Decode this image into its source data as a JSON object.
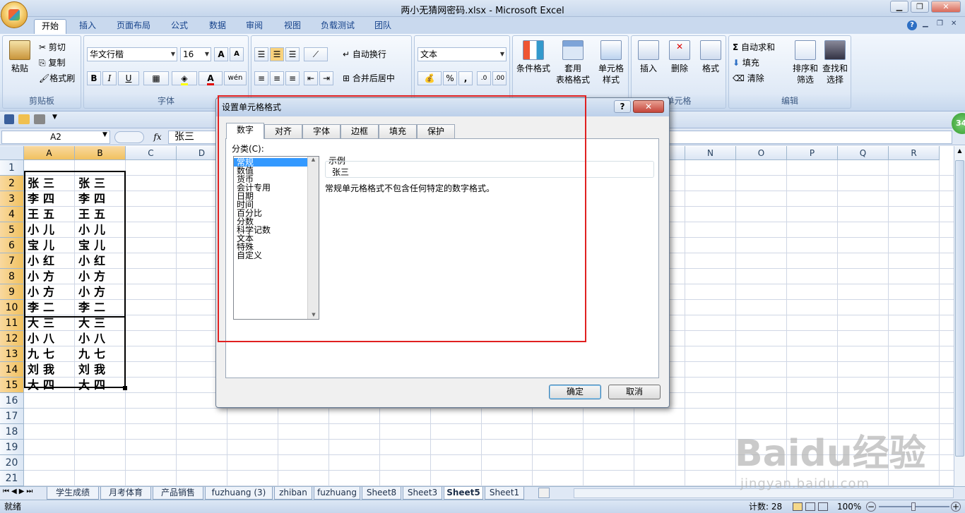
{
  "window": {
    "title": "两小无猜网密码.xlsx - Microsoft Excel"
  },
  "ribbon": {
    "tabs": [
      "开始",
      "插入",
      "页面布局",
      "公式",
      "数据",
      "审阅",
      "视图",
      "负载测试",
      "团队"
    ],
    "active_tab": "开始",
    "clipboard": {
      "paste": "粘贴",
      "cut": "剪切",
      "copy": "复制",
      "format_painter": "格式刷",
      "group": "剪贴板"
    },
    "font": {
      "name": "华文行楷",
      "size": "16",
      "bold": "B",
      "italic": "I",
      "underline": "U",
      "phonetic": "wén",
      "group": "字体"
    },
    "alignment": {
      "wrap": "自动换行",
      "merge": "合并后居中"
    },
    "number": {
      "format": "文本",
      "percent": "%",
      "comma": ","
    },
    "styles": {
      "conditional": "条件格式",
      "table": "套用\n表格格式",
      "cell": "单元格\n样式"
    },
    "cells": {
      "insert": "插入",
      "delete": "删除",
      "format": "格式",
      "group": "单元格"
    },
    "editing": {
      "autosum": "自动求和",
      "fill": "填充",
      "clear": "清除",
      "sort": "排序和\n筛选",
      "find": "查找和\n选择",
      "group": "编辑"
    }
  },
  "formula_bar": {
    "name_box": "A2",
    "fx": "fx",
    "content": "张三"
  },
  "grid": {
    "columns": [
      "A",
      "B",
      "C",
      "D",
      "E",
      "F",
      "G",
      "H",
      "I",
      "J",
      "K",
      "L",
      "M",
      "N",
      "O",
      "P",
      "Q",
      "R"
    ],
    "rows": [
      "1",
      "2",
      "3",
      "4",
      "5",
      "6",
      "7",
      "8",
      "9",
      "10",
      "11",
      "12",
      "13",
      "14",
      "15",
      "16",
      "17",
      "18",
      "19",
      "20",
      "21",
      "22"
    ],
    "names": [
      "张三",
      "李四",
      "王五",
      "小儿",
      "宝儿",
      "小红",
      "小方",
      "小方",
      "李二",
      "大三",
      "小八",
      "九七",
      "刘我",
      "大四"
    ]
  },
  "sheet_tabs": [
    "学生成绩",
    "月考体育",
    "产品销售",
    "fuzhuang (3)",
    "zhiban",
    "fuzhuang",
    "Sheet8",
    "Sheet3",
    "Sheet5",
    "Sheet1"
  ],
  "active_sheet": "Sheet5",
  "status": {
    "ready": "就绪",
    "count": "计数: 28",
    "zoom": "100%"
  },
  "dialog": {
    "title": "设置单元格格式",
    "help": "?",
    "tabs": [
      "数字",
      "对齐",
      "字体",
      "边框",
      "填充",
      "保护"
    ],
    "category_label": "分类(C):",
    "categories": [
      "常规",
      "数值",
      "货币",
      "会计专用",
      "日期",
      "时间",
      "百分比",
      "分数",
      "科学记数",
      "文本",
      "特殊",
      "自定义"
    ],
    "sample_label": "示例",
    "sample_value": "张三",
    "description": "常规单元格格式不包含任何特定的数字格式。",
    "ok": "确定",
    "cancel": "取消"
  },
  "badge": "34",
  "watermark": {
    "brand": "Baidu",
    "cn": "经验",
    "url": "jingyan.baidu.com"
  }
}
